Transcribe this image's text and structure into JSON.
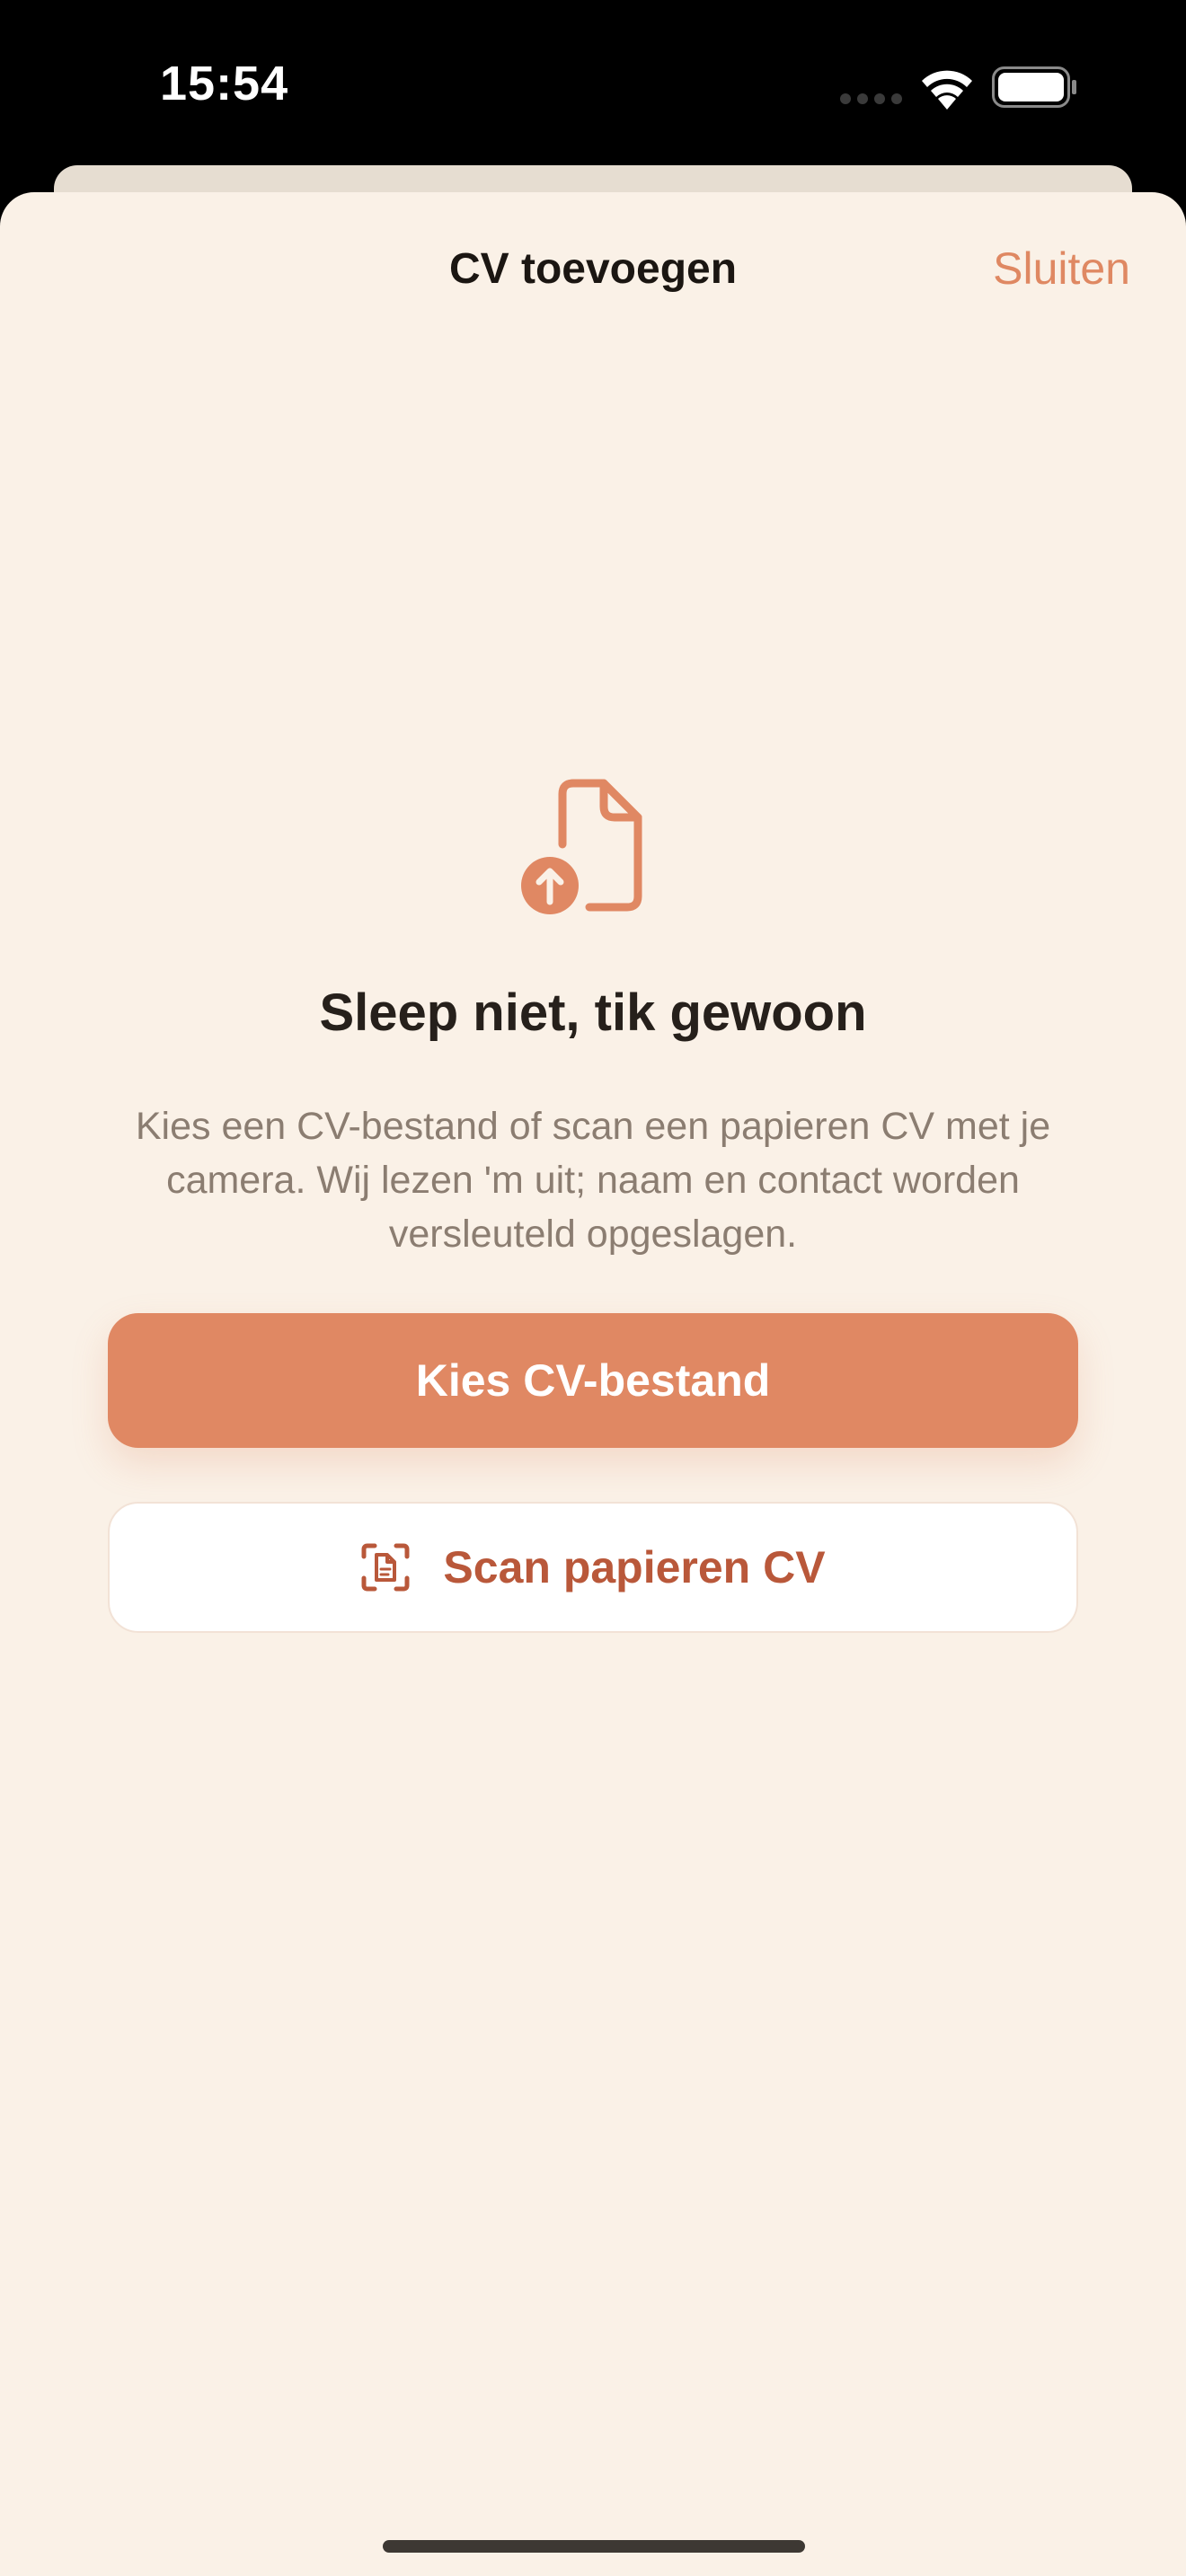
{
  "status_bar": {
    "time": "15:54",
    "icons": [
      "cellular-signal-icon",
      "wifi-icon",
      "battery-icon"
    ]
  },
  "sheet": {
    "title": "CV toevoegen",
    "close_label": "Sluiten"
  },
  "content": {
    "icon": "file-upload-icon",
    "heading": "Sleep niet, tik gewoon",
    "description": "Kies een CV-bestand of scan een papieren CV met je camera. Wij lezen 'm uit; naam en contact worden versleuteld opgeslagen."
  },
  "buttons": {
    "choose_file_label": "Kies CV-bestand",
    "scan_label": "Scan papieren CV",
    "scan_icon": "document-scan-icon"
  },
  "colors": {
    "accent": "#e08863",
    "accent_text": "#b9583a",
    "background": "#faf1e7",
    "close_link": "#df8862"
  }
}
